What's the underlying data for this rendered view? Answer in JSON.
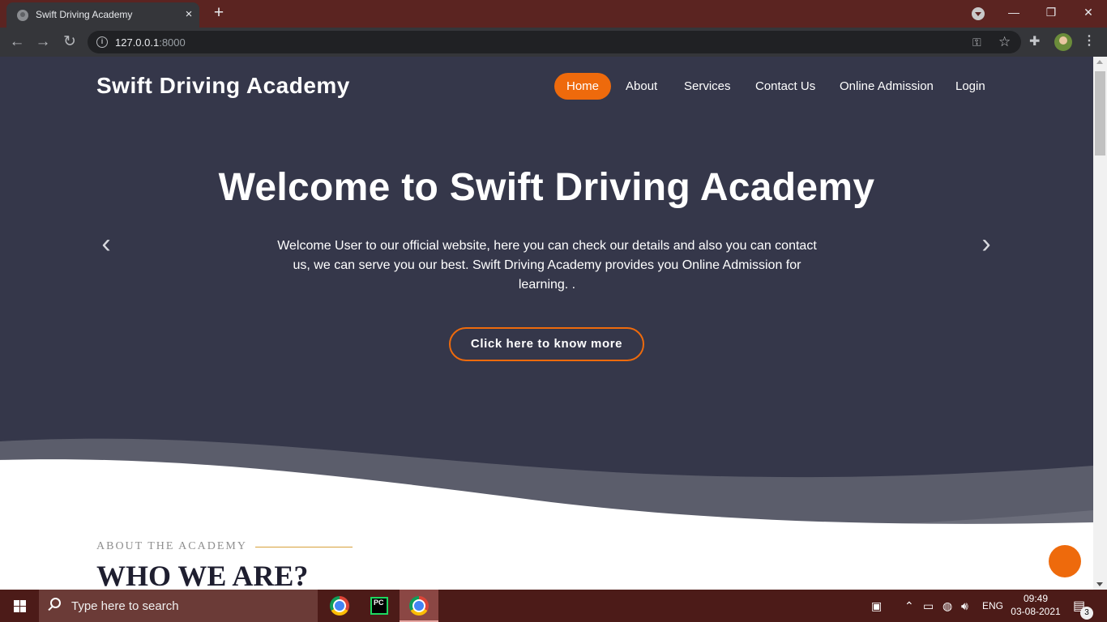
{
  "browser": {
    "tab_title": "Swift Driving Academy",
    "tab_close": "×",
    "new_tab": "+",
    "url_host": "127.0.0.1",
    "url_port": ":8000",
    "window_minimize": "—",
    "window_restore": "❐",
    "window_close": "✕"
  },
  "site": {
    "brand": "Swift Driving Academy",
    "nav": [
      "Home",
      "About",
      "Services",
      "Contact Us",
      "Online Admission",
      "Login"
    ],
    "active_nav": "Home",
    "accent_color": "#ee6a0c",
    "hero_bg_color": "#35374a",
    "hero": {
      "title": "Welcome to Swift Driving Academy",
      "text": "Welcome User to our official website, here you can check our details and also you can contact us, we can serve you our best. Swift Driving Academy provides you Online Admission for learning. .",
      "cta": "Click here to know more",
      "prev_arrow": "‹",
      "next_arrow": "›"
    },
    "about": {
      "label": "ABOUT THE ACADEMY",
      "heading": "WHO WE ARE?"
    }
  },
  "taskbar": {
    "search_placeholder": "Type here to search",
    "language": "ENG",
    "time": "09:49",
    "date": "03-08-2021",
    "notification_count": "3"
  }
}
